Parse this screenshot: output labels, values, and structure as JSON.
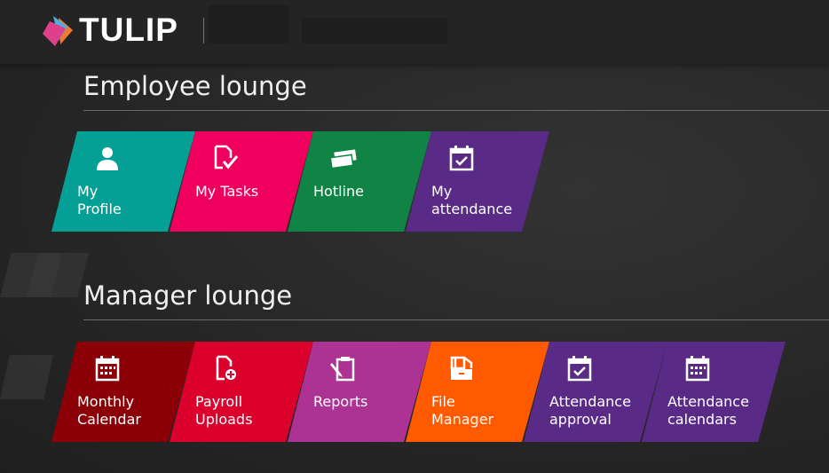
{
  "header": {
    "brand": "TULIP"
  },
  "employee": {
    "title": "Employee lounge",
    "tiles": [
      {
        "label": "My\nProfile",
        "icon": "user-icon",
        "color": "#05a095"
      },
      {
        "label": "My Tasks",
        "icon": "document-check-icon",
        "color": "#f0005e"
      },
      {
        "label": "Hotline",
        "icon": "cards-icon",
        "color": "#0f8444"
      },
      {
        "label": "My\nattendance",
        "icon": "calendar-check-icon",
        "color": "#5a2a87"
      }
    ]
  },
  "manager": {
    "title": "Manager lounge",
    "tiles": [
      {
        "label": "Monthly\nCalendar",
        "icon": "calendar-icon",
        "color": "#8c0008"
      },
      {
        "label": "Payroll\nUploads",
        "icon": "document-add-icon",
        "color": "#dc002c"
      },
      {
        "label": "Reports",
        "icon": "clipboard-pencil-icon",
        "color": "#ac3393"
      },
      {
        "label": "File\nManager",
        "icon": "file-cabinet-icon",
        "color": "#ff5a00"
      },
      {
        "label": "Attendance\napproval",
        "icon": "calendar-check-icon",
        "color": "#5a2a87"
      },
      {
        "label": "Attendance\ncalendars",
        "icon": "calendar-icon",
        "color": "#5a2a87"
      }
    ]
  }
}
